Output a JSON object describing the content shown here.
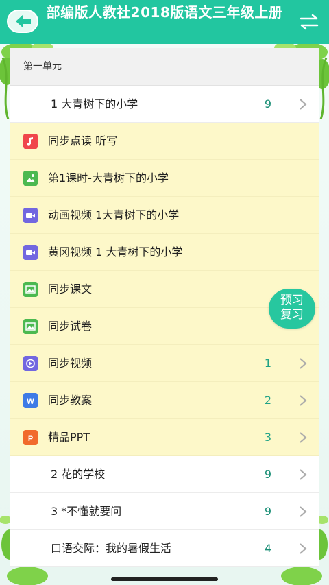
{
  "header": {
    "title": "部编版人教社2018版语文三年级上册",
    "back_icon": "arrow-left-icon",
    "switch_icon": "swap-arrows-icon"
  },
  "section": {
    "title": "第一单元"
  },
  "lessons": [
    {
      "label": "1 大青树下的小学",
      "count": "9"
    },
    {
      "label": "2 花的学校",
      "count": "9"
    },
    {
      "label": "3 *不懂就要问",
      "count": "9"
    },
    {
      "label": "口语交际：我的暑假生活",
      "count": "4"
    }
  ],
  "resources": [
    {
      "label": "同步点读 听写",
      "icon": "music-file-icon",
      "color": "#f0464b",
      "count": ""
    },
    {
      "label": "第1课时-大青树下的小学",
      "icon": "image-file-icon",
      "color": "#4cb950",
      "count": ""
    },
    {
      "label": "动画视频 1大青树下的小学",
      "icon": "video-file-icon",
      "color": "#7267e0",
      "count": ""
    },
    {
      "label": "黄冈视频 1 大青树下的小学",
      "icon": "video-file-icon",
      "color": "#7267e0",
      "count": ""
    },
    {
      "label": "同步课文",
      "icon": "image-file-icon",
      "color": "#4cb950",
      "count": ""
    },
    {
      "label": "同步试卷",
      "icon": "image-file-icon",
      "color": "#4cb950",
      "count": ""
    },
    {
      "label": "同步视频",
      "icon": "video-folder-icon",
      "color": "#7267e0",
      "count": "1"
    },
    {
      "label": "同步教案",
      "icon": "word-file-icon",
      "color": "#3e7be6",
      "count": "2"
    },
    {
      "label": "精品PPT",
      "icon": "ppt-file-icon",
      "color": "#f16a2c",
      "count": "3"
    }
  ],
  "float_button": {
    "line1": "预习",
    "line2": "复习"
  }
}
